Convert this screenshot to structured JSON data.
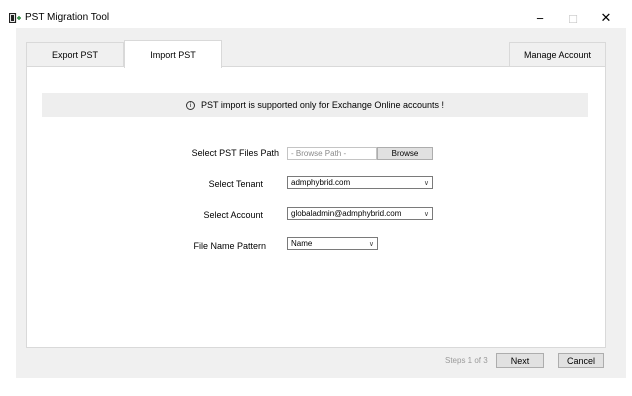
{
  "window": {
    "title": "PST Migration Tool",
    "minimize": "−",
    "maximize": "□",
    "close": "✕"
  },
  "tabs": [
    {
      "label": "Export PST",
      "active": false
    },
    {
      "label": "Import PST",
      "active": true
    },
    {
      "label": "Manage Account",
      "active": false
    }
  ],
  "info": {
    "icon": "info-circle-icon",
    "text": "PST import is supported only for Exchange Online accounts !"
  },
  "form": {
    "pst_path": {
      "label": "Select PST Files Path",
      "placeholder": "- Browse Path -",
      "browse_label": "Browse"
    },
    "tenant": {
      "label": "Select Tenant",
      "value": "admphybrid.com"
    },
    "account": {
      "label": "Select Account",
      "value": "globaladmin@admphybrid.com"
    },
    "pattern": {
      "label": "File Name Pattern",
      "value": "Name"
    }
  },
  "footer": {
    "steps": "Steps 1 of 3",
    "next_label": "Next",
    "cancel_label": "Cancel"
  },
  "colors": {
    "accent": "#2b8a3e",
    "window_bg": "#f0f0f0",
    "info_bg": "#eeeeee"
  }
}
